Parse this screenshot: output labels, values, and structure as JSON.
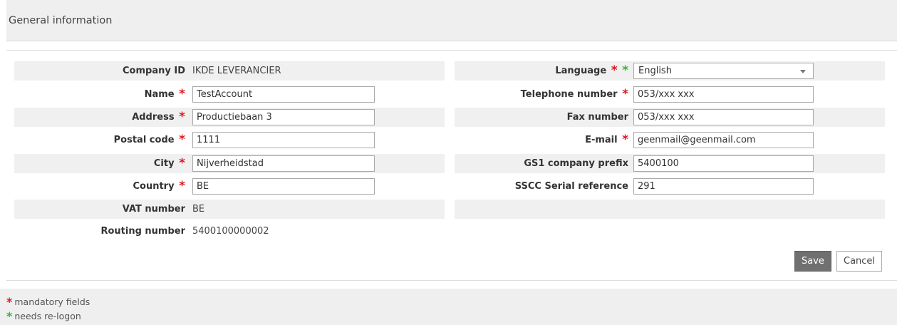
{
  "header": {
    "title": "General information"
  },
  "left_fields": [
    {
      "label": "Company ID",
      "value": "IKDE LEVERANCIER",
      "type": "text"
    },
    {
      "label": "Name",
      "value": "TestAccount",
      "type": "input"
    },
    {
      "label": "Address",
      "value": "Productiebaan 3",
      "type": "input"
    },
    {
      "label": "Postal code",
      "value": "1111",
      "type": "input"
    },
    {
      "label": "City",
      "value": "Nijverheidstad",
      "type": "input"
    },
    {
      "label": "Country",
      "value": "BE",
      "type": "input"
    },
    {
      "label": "VAT number",
      "value": "BE",
      "type": "text"
    },
    {
      "label": "Routing number",
      "value": "5400100000002",
      "type": "text"
    }
  ],
  "right_fields": [
    {
      "label": "Language",
      "value": "English",
      "type": "select"
    },
    {
      "label": "Telephone number",
      "value": "053/xxx xxx",
      "type": "input"
    },
    {
      "label": "Fax number",
      "value": "053/xxx xxx",
      "type": "input"
    },
    {
      "label": "E-mail",
      "value": "geenmail@geenmail.com",
      "type": "input"
    },
    {
      "label": "GS1 company prefix",
      "value": "5400100",
      "type": "input"
    },
    {
      "label": "SSCC Serial reference",
      "value": "291",
      "type": "input"
    }
  ],
  "markers": {
    "mandatory_star": "*",
    "relogon_star": "*"
  },
  "buttons": {
    "save": "Save",
    "cancel": "Cancel"
  },
  "legend": {
    "mandatory": "mandatory fields",
    "relogon": "needs re-logon"
  },
  "colors": {
    "mandatory_star": "#e0161e",
    "relogon_star": "#2fb839",
    "save_button": "#707070"
  }
}
